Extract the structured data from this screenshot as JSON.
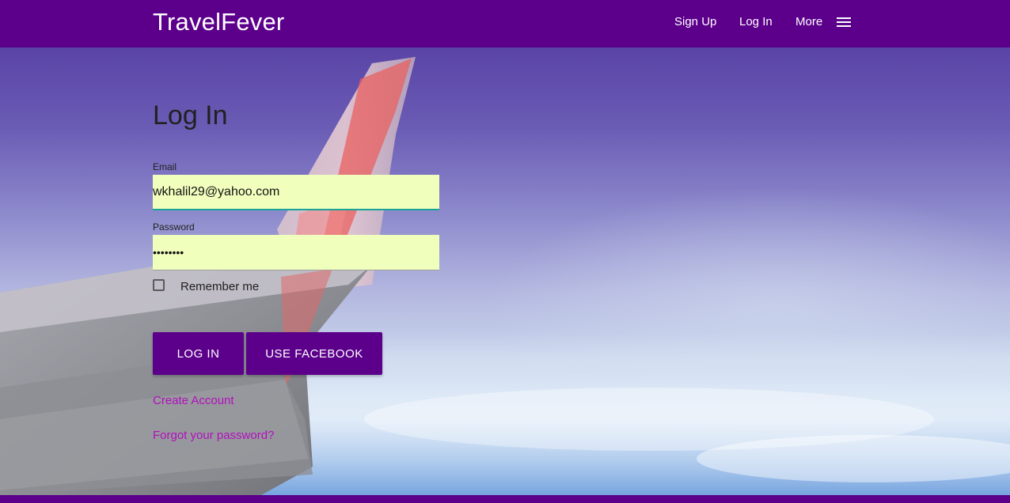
{
  "navbar": {
    "brand": "TravelFever",
    "links": [
      {
        "label": "Sign Up"
      },
      {
        "label": "Log In"
      },
      {
        "label": "More"
      }
    ],
    "menu_icon": "hamburger-menu-icon",
    "background": "#5c008c"
  },
  "form": {
    "title": "Log In",
    "email_label": "Email",
    "email_value": "wkhalil29@yahoo.com",
    "password_label": "Password",
    "password_value": "••••••••",
    "remember_label": "Remember me",
    "remember_checked": false,
    "login_button": "Log In",
    "facebook_button": "Use Facebook",
    "create_account_link": "Create Account",
    "forgot_password_link": "Forgot your password?"
  },
  "colors": {
    "brand_purple": "#5c008c",
    "input_autofill": "#f1ffbd",
    "link": "#b20fbd",
    "focus_underline": "#1aa39a"
  }
}
